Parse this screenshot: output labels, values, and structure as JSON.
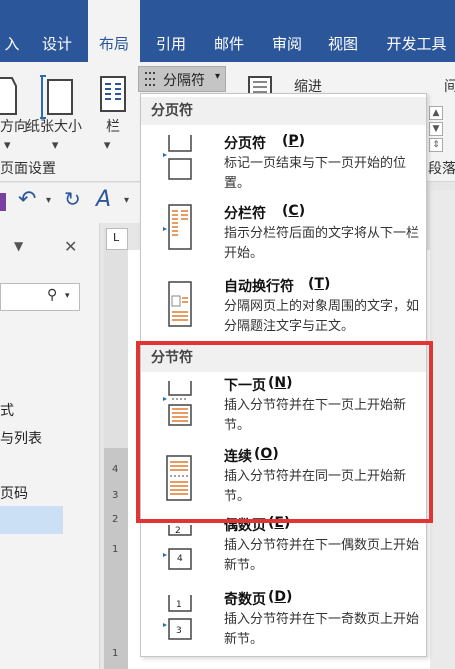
{
  "ribbon_tabs": [
    "入",
    "设计",
    "布局",
    "引用",
    "邮件",
    "审阅",
    "视图",
    "开发工具"
  ],
  "active_tab": "布局",
  "ribbon": {
    "orientation_label": "方向",
    "size_label": "纸张大小",
    "columns_label": "栏",
    "page_setup_group": "页面设置",
    "breaks_button": "分隔符",
    "indent_label": "缩进",
    "spacing_label": "间",
    "paragraph_group": "段落"
  },
  "nav": {
    "close_glyph": "✕",
    "items": [
      "式",
      "与列表",
      "页码"
    ]
  },
  "ruler": {
    "corner": "L",
    "numbers": [
      "4",
      "3",
      "2",
      "1",
      "1"
    ]
  },
  "menu": {
    "section_page": "分页符",
    "section_section": "分节符",
    "items": [
      {
        "title": "分页符",
        "key": "P",
        "desc": "标记一页结束与下一页开始的位置。"
      },
      {
        "title": "分栏符",
        "key": "C",
        "desc": "指示分栏符后面的文字将从下一栏开始。"
      },
      {
        "title": "自动换行符",
        "key": "T",
        "desc": "分隔网页上的对象周围的文字，如分隔题注文字与正文。"
      },
      {
        "title": "下一页",
        "key": "N",
        "desc": "插入分节符并在下一页上开始新节。"
      },
      {
        "title": "连续",
        "key": "O",
        "desc": "插入分节符并在同一页上开始新节。"
      },
      {
        "title": "偶数页",
        "key": "E",
        "desc": "插入分节符并在下一偶数页上开始新节。"
      },
      {
        "title": "奇数页",
        "key": "D",
        "desc": "插入分节符并在下一奇数页上开始新节。"
      }
    ]
  },
  "colors": {
    "accent": "#2b579a",
    "highlight": "#e03535"
  }
}
